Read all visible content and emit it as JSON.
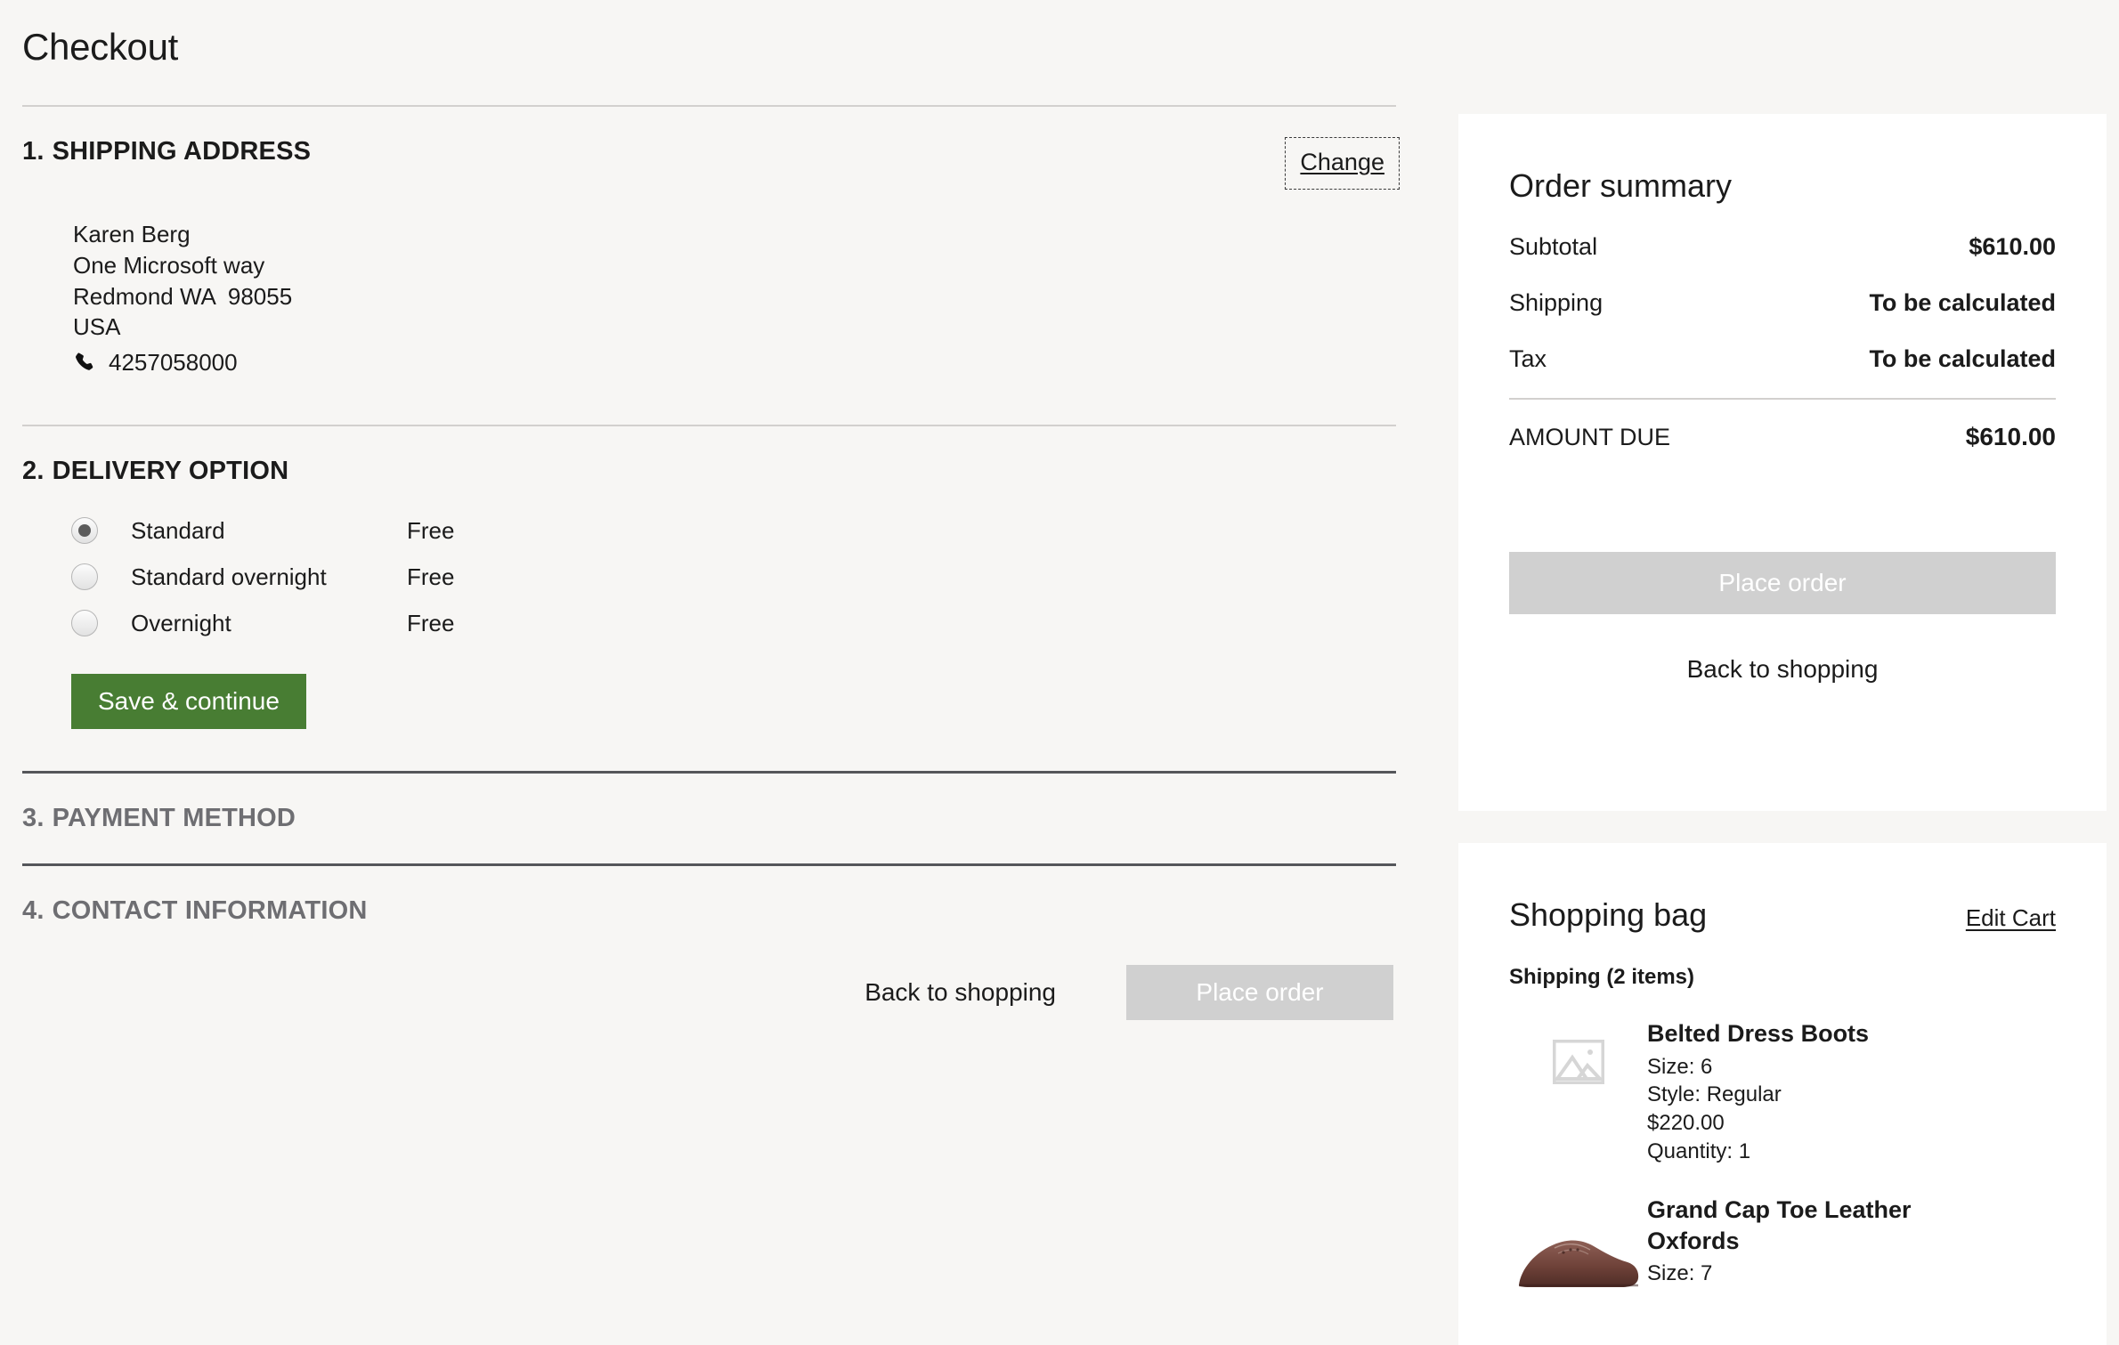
{
  "page": {
    "title": "Checkout"
  },
  "sections": {
    "shipping": {
      "number": "1.",
      "title": "SHIPPING ADDRESS",
      "change_label": "Change",
      "address": {
        "name": "Karen Berg",
        "street": "One Microsoft way",
        "city_state_zip": "Redmond WA  98055",
        "country": "USA",
        "phone": "4257058000",
        "phone_icon": "phone-icon"
      }
    },
    "delivery": {
      "number": "2.",
      "title": "DELIVERY OPTION",
      "options": [
        {
          "label": "Standard",
          "price": "Free",
          "selected": true
        },
        {
          "label": "Standard overnight",
          "price": "Free",
          "selected": false
        },
        {
          "label": "Overnight",
          "price": "Free",
          "selected": false
        }
      ],
      "save_label": "Save & continue"
    },
    "payment": {
      "number": "3.",
      "title": "PAYMENT METHOD"
    },
    "contact": {
      "number": "4.",
      "title": "CONTACT INFORMATION"
    }
  },
  "bottom_actions": {
    "back_label": "Back to shopping",
    "place_order_label": "Place order"
  },
  "order_summary": {
    "title": "Order summary",
    "rows": [
      {
        "label": "Subtotal",
        "value": "$610.00"
      },
      {
        "label": "Shipping",
        "value": "To be calculated"
      },
      {
        "label": "Tax",
        "value": "To be calculated"
      }
    ],
    "total_label": "AMOUNT DUE",
    "total_value": "$610.00",
    "place_order_label": "Place order",
    "back_label": "Back to shopping"
  },
  "shopping_bag": {
    "title": "Shopping bag",
    "edit_label": "Edit Cart",
    "group_label": "Shipping (2 items)",
    "items": [
      {
        "name": "Belted Dress Boots",
        "size": "Size: 6",
        "style": "Style: Regular",
        "price": "$220.00",
        "quantity": "Quantity: 1",
        "thumb": "image-placeholder-icon"
      },
      {
        "name": "Grand Cap Toe Leather Oxfords",
        "size": "Size: 7",
        "thumb": "leather-shoe-photo"
      }
    ]
  },
  "colors": {
    "page_background": "#f7f6f4",
    "panel_background": "#ffffff",
    "primary_button": "#487d33",
    "disabled_button": "#d0d0d0",
    "inactive_heading": "#6e6e72",
    "divider": "#d2d0ce",
    "divider_dark": "#55565a"
  }
}
